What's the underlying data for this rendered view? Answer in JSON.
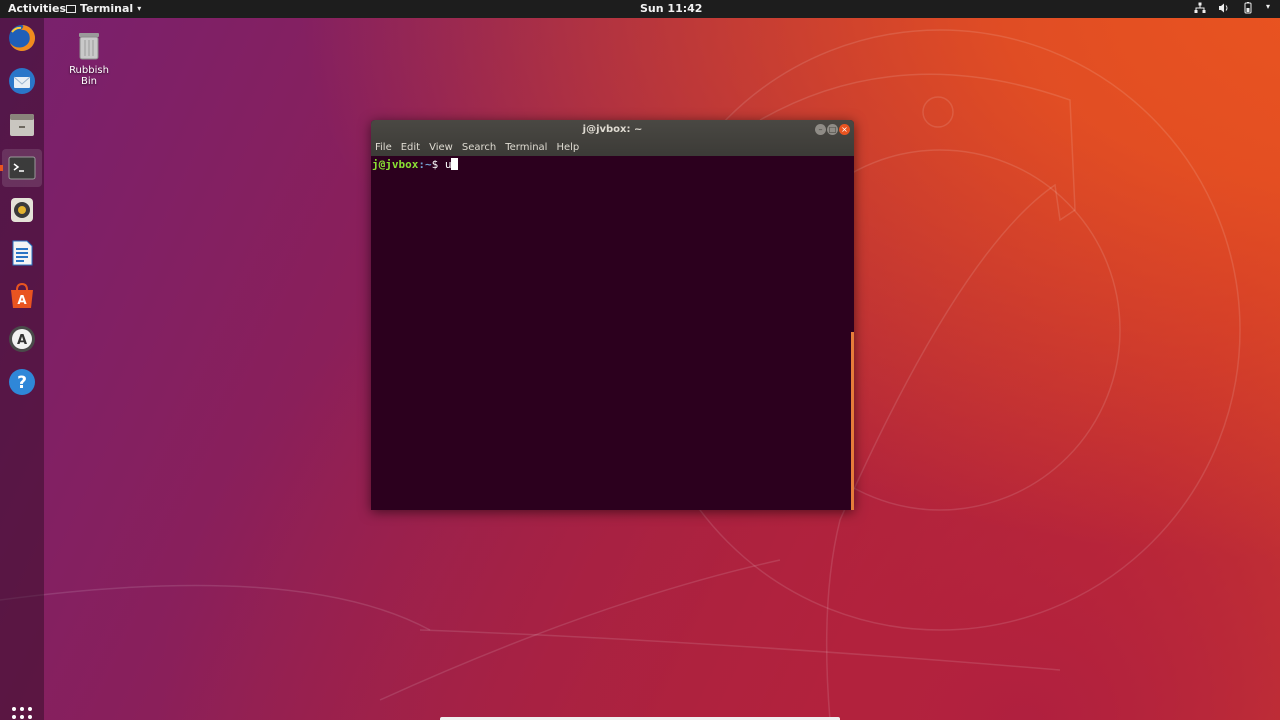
{
  "topbar": {
    "activities": "Activities",
    "app_menu": "Terminal",
    "clock": "Sun 11:42"
  },
  "dock": {
    "items": [
      {
        "icon": "firefox-icon"
      },
      {
        "icon": "thunderbird-icon"
      },
      {
        "icon": "files-icon"
      },
      {
        "icon": "terminal-icon"
      },
      {
        "icon": "rhythmbox-icon"
      },
      {
        "icon": "libreoffice-writer-icon"
      },
      {
        "icon": "software-center-icon"
      },
      {
        "icon": "software-updater-icon"
      },
      {
        "icon": "help-icon"
      }
    ],
    "show_apps_icon": "apps-grid-icon"
  },
  "desktop": {
    "trash_label": "Rubbish Bin"
  },
  "terminal": {
    "title": "j@jvbox: ~",
    "menu": [
      "File",
      "Edit",
      "View",
      "Search",
      "Terminal",
      "Help"
    ],
    "prompt_user": "j@jvbox",
    "prompt_path": ":~",
    "prompt_symbol": "$ ",
    "typed": "u"
  },
  "colors": {
    "accent": "#e95420",
    "terminal_bg": "#2c001e",
    "prompt_green": "#8ae234",
    "prompt_blue": "#729fcf"
  }
}
